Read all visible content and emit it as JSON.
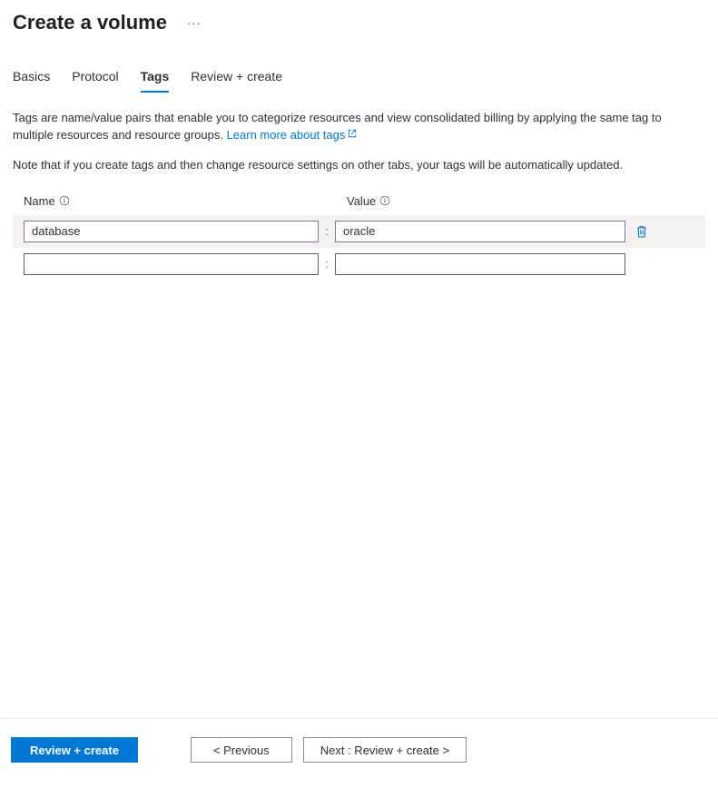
{
  "header": {
    "title": "Create a volume"
  },
  "tabs": {
    "items": [
      {
        "label": "Basics"
      },
      {
        "label": "Protocol"
      },
      {
        "label": "Tags"
      },
      {
        "label": "Review + create"
      }
    ],
    "activeIndex": 2
  },
  "description": {
    "text": "Tags are name/value pairs that enable you to categorize resources and view consolidated billing by applying the same tag to multiple resources and resource groups. ",
    "linkText": "Learn more about tags"
  },
  "note": "Note that if you create tags and then change resource settings on other tabs, your tags will be automatically updated.",
  "columns": {
    "name": "Name",
    "value": "Value"
  },
  "rows": [
    {
      "name": "database",
      "value": "oracle",
      "filled": true
    },
    {
      "name": "",
      "value": "",
      "filled": false
    }
  ],
  "footer": {
    "review": "Review + create",
    "previous": "< Previous",
    "next": "Next : Review + create >"
  }
}
